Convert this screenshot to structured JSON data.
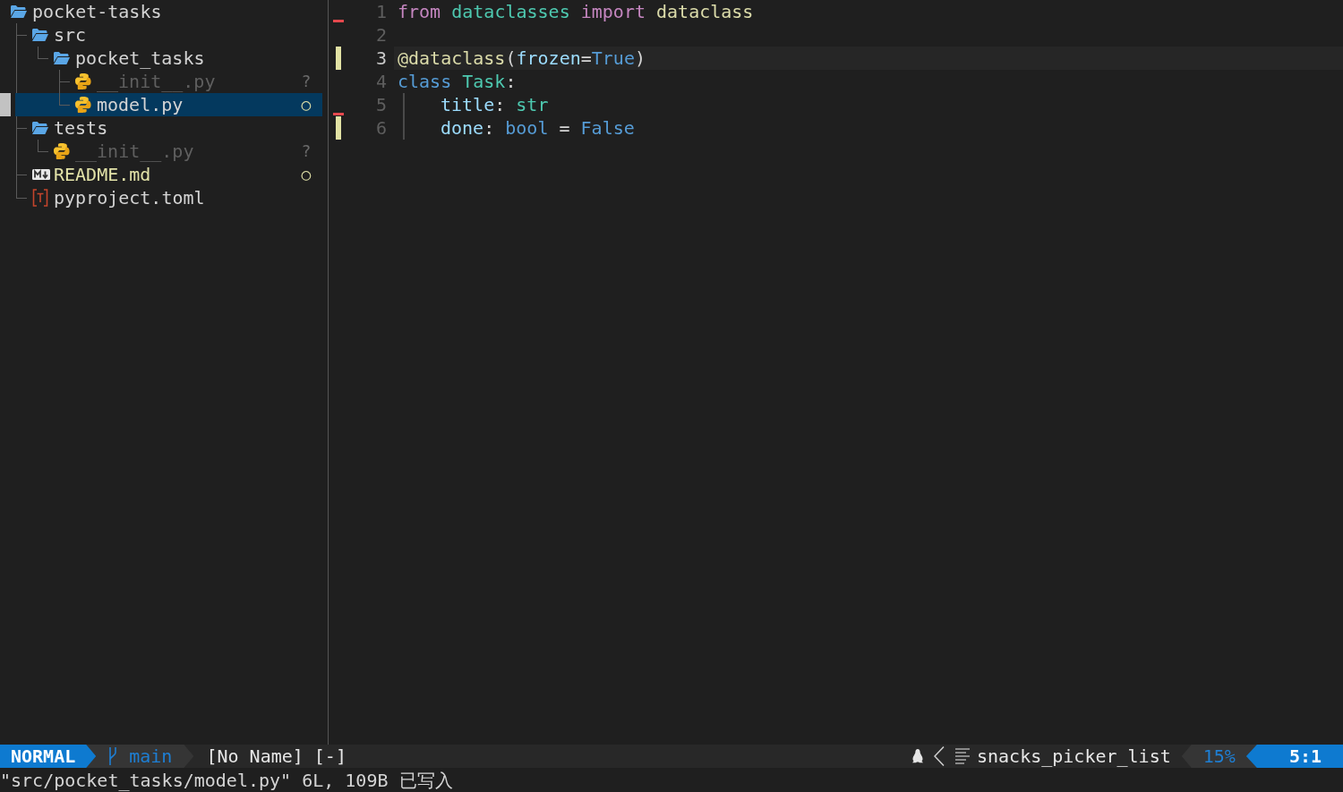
{
  "explorer": {
    "items": [
      {
        "name": "pocket-tasks",
        "kind": "folder",
        "expanded": true,
        "selected": false,
        "children": [
          {
            "name": "src",
            "kind": "folder",
            "expanded": true,
            "selected": false,
            "children": [
              {
                "name": "pocket_tasks",
                "kind": "folder",
                "expanded": true,
                "selected": false,
                "children": [
                  {
                    "name": "__init__.py",
                    "kind": "python",
                    "selected": false,
                    "untracked": true,
                    "modified": false,
                    "badge": "?"
                  },
                  {
                    "name": "model.py",
                    "kind": "python",
                    "selected": true,
                    "untracked": false,
                    "modified": true,
                    "badge": "○"
                  }
                ]
              }
            ]
          },
          {
            "name": "tests",
            "kind": "folder",
            "expanded": true,
            "selected": false,
            "children": [
              {
                "name": "__init__.py",
                "kind": "python",
                "selected": false,
                "untracked": true,
                "modified": false,
                "badge": "?"
              }
            ]
          },
          {
            "name": "README.md",
            "kind": "markdown",
            "selected": false,
            "untracked": false,
            "modified": true,
            "badge": "○"
          },
          {
            "name": "pyproject.toml",
            "kind": "toml",
            "selected": false,
            "untracked": false,
            "modified": false
          }
        ]
      }
    ]
  },
  "editor": {
    "lines": [
      {
        "number": "1",
        "changed": false,
        "deletion_below": true,
        "current": false,
        "indented": false,
        "tokens": [
          {
            "text": "from ",
            "kind": "keyword"
          },
          {
            "text": "dataclasses ",
            "kind": "module"
          },
          {
            "text": "import ",
            "kind": "keyword"
          },
          {
            "text": "dataclass",
            "kind": "function"
          }
        ]
      },
      {
        "number": "2",
        "changed": false,
        "deletion_below": false,
        "current": false,
        "indented": false
      },
      {
        "number": "3",
        "changed": true,
        "deletion_below": false,
        "current": true,
        "indented": false,
        "tokens": [
          {
            "text": "@dataclass",
            "kind": "function"
          },
          {
            "text": "(",
            "kind": "punctuation"
          },
          {
            "text": "frozen",
            "kind": "variable"
          },
          {
            "text": "=",
            "kind": "punctuation"
          },
          {
            "text": "True",
            "kind": "constant"
          },
          {
            "text": ")",
            "kind": "punctuation"
          }
        ]
      },
      {
        "number": "4",
        "changed": false,
        "deletion_below": false,
        "current": false,
        "indented": false,
        "tokens": [
          {
            "text": "class ",
            "kind": "storage"
          },
          {
            "text": "Task",
            "kind": "type"
          },
          {
            "text": ":",
            "kind": "punctuation"
          }
        ]
      },
      {
        "number": "5",
        "changed": false,
        "deletion_below": true,
        "current": false,
        "indented": true,
        "tokens": [
          {
            "text": "title",
            "kind": "variable"
          },
          {
            "text": ": ",
            "kind": "punctuation"
          },
          {
            "text": "str",
            "kind": "type"
          }
        ]
      },
      {
        "number": "6",
        "changed": true,
        "deletion_below": false,
        "current": false,
        "indented": true,
        "tokens": [
          {
            "text": "done",
            "kind": "variable"
          },
          {
            "text": ": ",
            "kind": "punctuation"
          },
          {
            "text": "bool",
            "kind": "constant"
          },
          {
            "text": " = ",
            "kind": "punctuation"
          },
          {
            "text": "False",
            "kind": "constant"
          }
        ]
      }
    ]
  },
  "status_bar": {
    "mode": "NORMAL",
    "branch": "main",
    "buffer_name": "[No Name]",
    "buffer_flag": "[-]",
    "filetype": "snacks_picker_list",
    "progress": "15%",
    "position": "5:1"
  },
  "command_line": {
    "message": "\"src/pocket_tasks/model.py\" 6L, 109B 已写入"
  }
}
